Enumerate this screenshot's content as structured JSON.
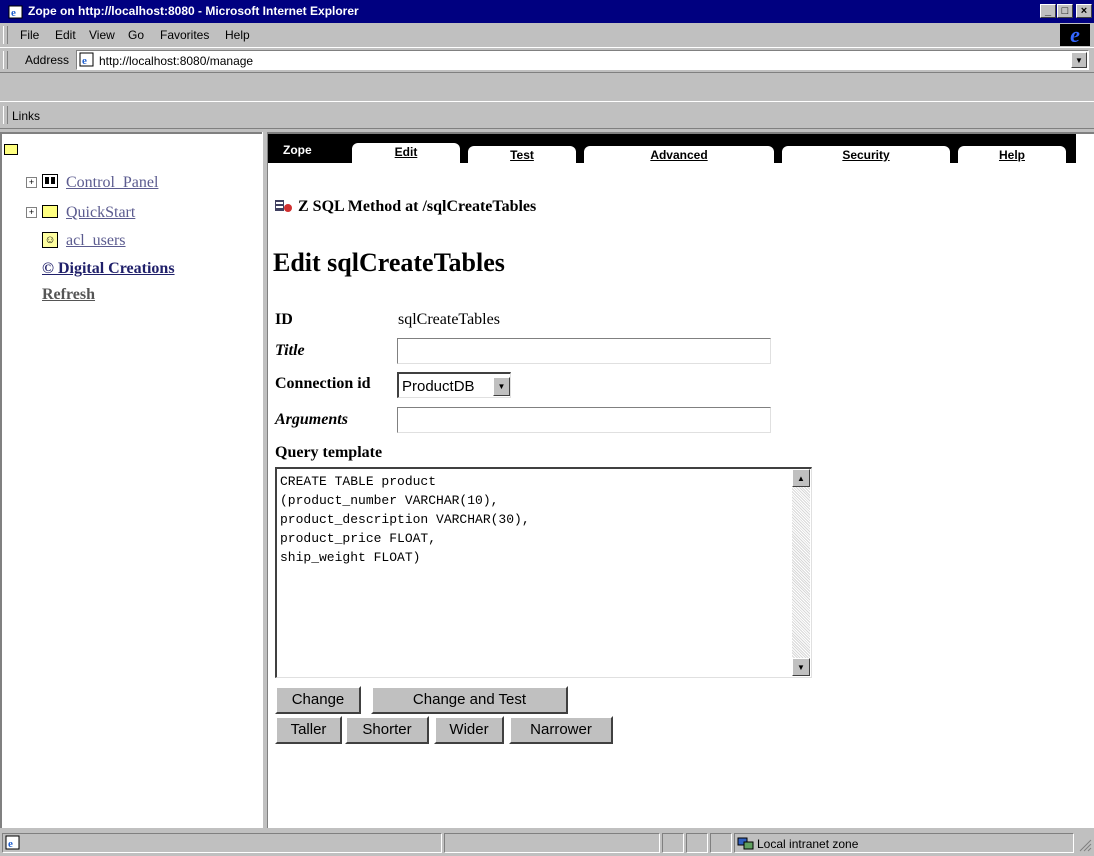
{
  "window": {
    "title": "Zope on http://localhost:8080 - Microsoft Internet Explorer",
    "min": "_",
    "max": "□",
    "close": "×"
  },
  "menu": [
    {
      "label": "File",
      "key": "F"
    },
    {
      "label": "Edit",
      "key": "E"
    },
    {
      "label": "View",
      "key": "V"
    },
    {
      "label": "Go",
      "key": "G"
    },
    {
      "label": "Favorites",
      "key": "a"
    },
    {
      "label": "Help",
      "key": "H"
    }
  ],
  "address": {
    "label": "Address",
    "url": "http://localhost:8080/manage"
  },
  "links": {
    "label": "Links"
  },
  "tree": {
    "items": [
      {
        "label": "Control_Panel"
      },
      {
        "label": "QuickStart"
      },
      {
        "label": "acl_users"
      }
    ],
    "copyright": "© Digital Creations",
    "refresh": "Refresh"
  },
  "tabs": {
    "zope": "Zope",
    "items": [
      "Edit",
      "Test",
      "Advanced",
      "Security",
      "Help"
    ]
  },
  "page": {
    "meta_type": "Z SQL Method at /sqlCreateTables",
    "heading": "Edit sqlCreateTables",
    "id_label": "ID",
    "id_value": "sqlCreateTables",
    "title_label": "Title",
    "title_value": "",
    "connection_label": "Connection id",
    "connection_value": "ProductDB",
    "arguments_label": "Arguments",
    "arguments_value": "",
    "query_label": "Query template",
    "query": "CREATE TABLE product\n(product_number VARCHAR(10),\nproduct_description VARCHAR(30),\nproduct_price FLOAT,\nship_weight FLOAT)"
  },
  "buttons": {
    "change": "Change",
    "change_test": "Change and Test",
    "taller": "Taller",
    "shorter": "Shorter",
    "wider": "Wider",
    "narrower": "Narrower"
  },
  "status": {
    "zone": "Local intranet zone"
  },
  "colors": {
    "titlebar": "#000080",
    "link": "#5b5b8f",
    "tabstrip": "#000000"
  }
}
